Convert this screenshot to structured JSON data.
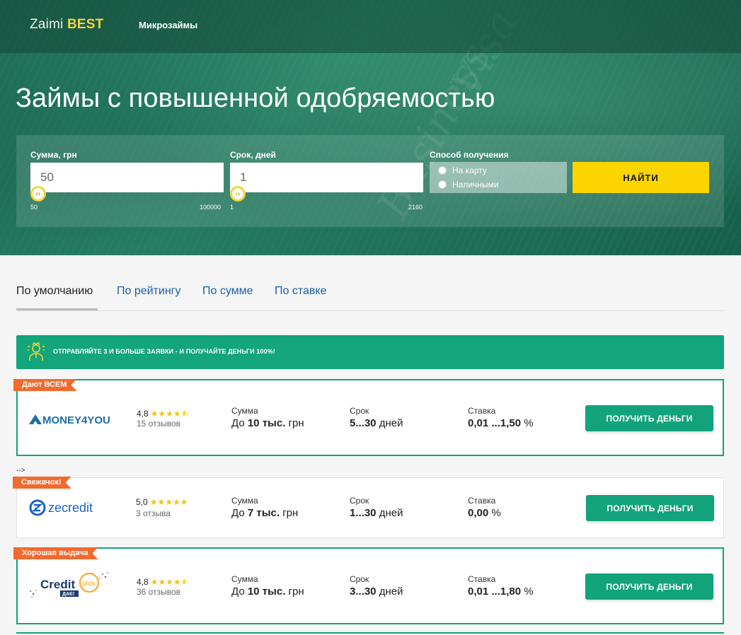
{
  "header": {
    "logo_main": "Zaimi",
    "logo_accent": "BEST",
    "nav_link": "Микрозаймы"
  },
  "hero": {
    "title": "Займы с повышенной одобряемостью"
  },
  "search": {
    "amount_label": "Сумма, грн",
    "amount_value": "50",
    "amount_min": "50",
    "amount_max": "100000",
    "term_label": "Срок, дней",
    "term_value": "1",
    "term_min": "1",
    "term_max": "2160",
    "method_label": "Способ получения",
    "method_options": [
      "На карту",
      "Наличными"
    ],
    "find_button": "НАЙТИ"
  },
  "sort_tabs": [
    {
      "label": "По умолчанию",
      "active": true
    },
    {
      "label": "По рейтингу",
      "active": false
    },
    {
      "label": "По сумме",
      "active": false
    },
    {
      "label": "По ставке",
      "active": false
    }
  ],
  "promo": {
    "text": "ОТПРАВЛЯЙТЕ 3 И БОЛЬШЕ ЗАЯВКИ - И ПОЛУЧАЙТЕ ДЕНЬГИ 100%!",
    "icon": "person-icon"
  },
  "stray_text": "-->",
  "offers": [
    {
      "badge": "Дают ВСЕМ",
      "brand": "MONEY4YOU",
      "rating": "4,8",
      "stars": "★★★★⯪",
      "reviews": "15 отзывов",
      "sum_label": "Сумма",
      "sum_prefix": "До",
      "sum_bold": "10 тыс.",
      "sum_suffix": "грн",
      "term_label": "Срок",
      "term_bold": "5...30",
      "term_suffix": "дней",
      "rate_label": "Ставка",
      "rate_bold": "0,01 ...1,50",
      "rate_suffix": "%",
      "button": "ПОЛУЧИТЬ ДЕНЬГИ"
    },
    {
      "badge": "Свежачок!",
      "brand": "zecredit",
      "rating": "5,0",
      "stars": "★★★★★",
      "reviews": "3 отзыва",
      "sum_label": "Сумма",
      "sum_prefix": "До",
      "sum_bold": "7 тыс.",
      "sum_suffix": "грн",
      "term_label": "Срок",
      "term_bold": "1...30",
      "term_suffix": "дней",
      "rate_label": "Ставка",
      "rate_bold": "0,00",
      "rate_suffix": "%",
      "button": "ПОЛУЧИТЬ ДЕНЬГИ"
    },
    {
      "badge": "Хорошая выдача",
      "brand": "Credit",
      "brand_sub": "plus",
      "brand_tag": "ДАЄ!",
      "rating": "4,8",
      "stars": "★★★★⯪",
      "reviews": "36 отзывов",
      "sum_label": "Сумма",
      "sum_prefix": "До",
      "sum_bold": "10 тыс.",
      "sum_suffix": "грн",
      "term_label": "Срок",
      "term_bold": "3...30",
      "term_suffix": "дней",
      "rate_label": "Ставка",
      "rate_bold": "0,01 ...1,80",
      "rate_suffix": "%",
      "button": "ПОЛУЧИТЬ ДЕНЬГИ"
    }
  ],
  "colors": {
    "accent_green": "#12a37b",
    "accent_yellow": "#fcd500",
    "badge_orange": "#f26a2e",
    "link_blue": "#1a5fa8"
  }
}
